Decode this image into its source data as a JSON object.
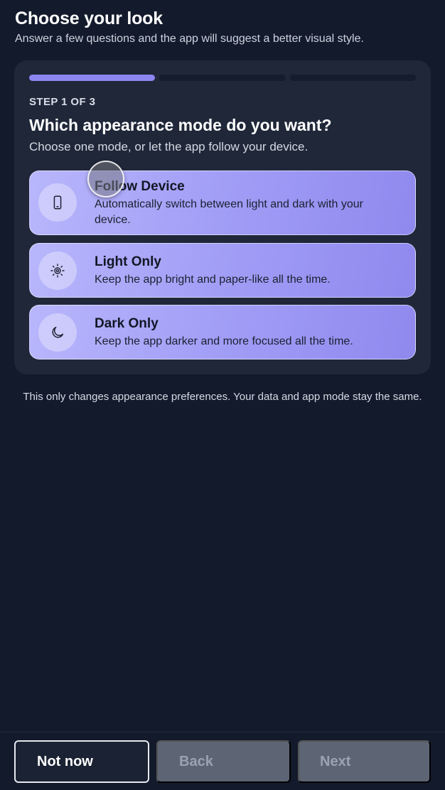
{
  "header": {
    "title": "Choose your look",
    "subtitle": "Answer a few questions and the app will suggest a better visual style."
  },
  "wizard": {
    "progress": {
      "current_step": 1,
      "total_steps": 3
    },
    "step_label": "STEP 1 OF 3",
    "question": "Which appearance mode do you want?",
    "question_hint": "Choose one mode, or let the app follow your device.",
    "options": [
      {
        "icon": "phone-icon",
        "title": "Follow Device",
        "description": "Automatically switch between light and dark with your device."
      },
      {
        "icon": "sun-icon",
        "title": "Light Only",
        "description": "Keep the app bright and paper-like all the time."
      },
      {
        "icon": "moon-icon",
        "title": "Dark Only",
        "description": "Keep the app darker and more focused all the time."
      }
    ]
  },
  "note": "This only changes appearance preferences. Your data and app mode stay the same.",
  "footer": {
    "not_now_label": "Not now",
    "back_label": "Back",
    "next_label": "Next"
  },
  "colors": {
    "background": "#131a2c",
    "card": "#1f2739",
    "accent": "#8b86f0",
    "option_gradient_start": "#b8b6fb",
    "option_gradient_end": "#8f89ee",
    "disabled_button": "#5d6474"
  }
}
